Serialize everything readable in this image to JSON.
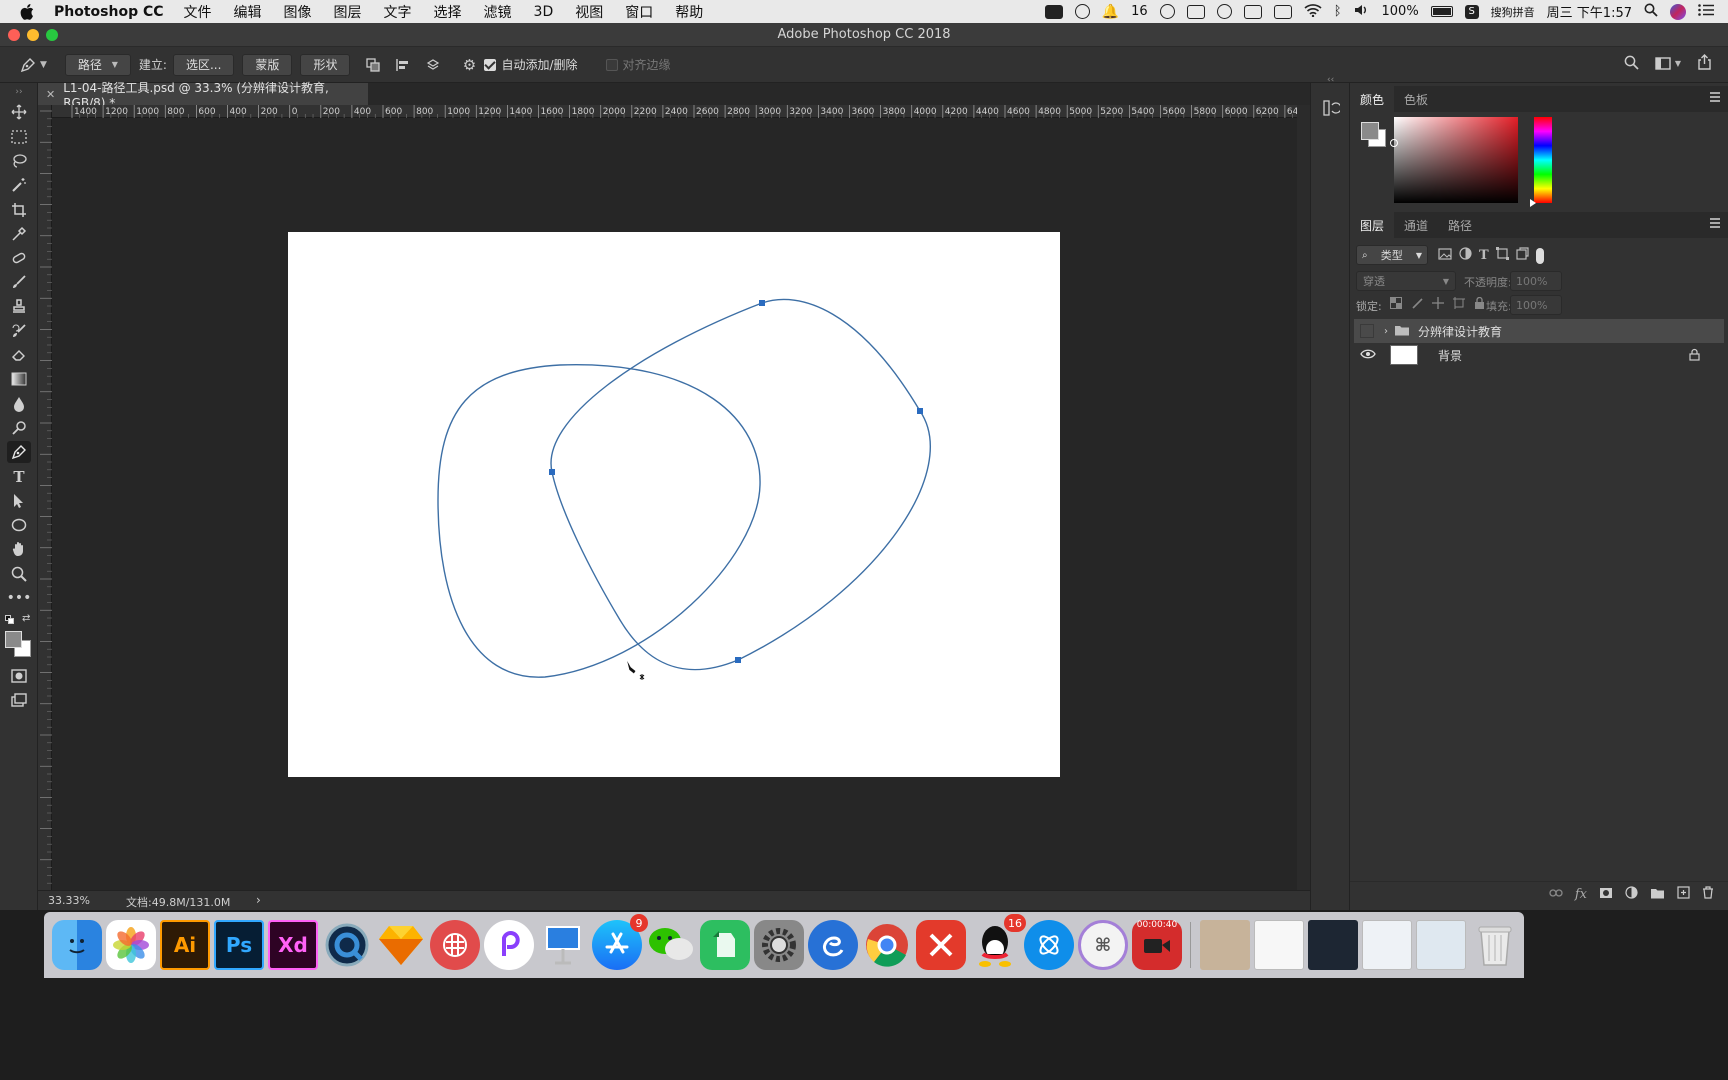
{
  "menubar": {
    "app_name": "Photoshop CC",
    "items": [
      "文件",
      "编辑",
      "图像",
      "图层",
      "文字",
      "选择",
      "滤镜",
      "3D",
      "视图",
      "窗口",
      "帮助"
    ],
    "status": {
      "notification_count": "16",
      "battery": "100%",
      "input_method": "搜狗拼音",
      "clock": "周三 下午1:57"
    }
  },
  "window": {
    "title": "Adobe Photoshop CC 2018",
    "traffic_colors": [
      "#fe5f57",
      "#febc2e",
      "#28c840"
    ]
  },
  "options": {
    "mode": "路径",
    "make_label": "建立:",
    "selection_btn": "选区...",
    "mask_btn": "蒙版",
    "shape_btn": "形状",
    "auto_add_delete": "自动添加/删除",
    "align_edges": "对齐边缘"
  },
  "toolbar": {
    "tools": [
      "move-tool",
      "marquee-tool",
      "lasso-tool",
      "magic-wand-tool",
      "crop-tool",
      "eyedropper-tool",
      "healing-brush-tool",
      "brush-tool",
      "clone-stamp-tool",
      "history-brush-tool",
      "eraser-tool",
      "gradient-tool",
      "blur-tool",
      "dodge-tool",
      "pen-tool",
      "type-tool",
      "path-selection-tool",
      "ellipse-tool",
      "hand-tool",
      "zoom-tool",
      "more-tools"
    ],
    "active": "pen-tool",
    "foreground_color": "#8a8a8a",
    "background_color": "#ffffff"
  },
  "document": {
    "tab_title": "L1-04-路径工具.psd @ 33.3% (分辨律设计教育, RGB/8) *",
    "zoom": "33.33%",
    "doc_size": "文档:49.8M/131.0M",
    "canvas_color": "#ffffff",
    "path_color": "#3d6fa5",
    "anchor_color": "#2a6bbf"
  },
  "hruler_labels": [
    "1400",
    "1200",
    "1000",
    "800",
    "600",
    "400",
    "200",
    "0",
    "200",
    "400",
    "600",
    "800",
    "1000",
    "1200",
    "1400",
    "1600",
    "1800",
    "2000",
    "2200",
    "2400",
    "2600",
    "2800",
    "3000",
    "3200",
    "3400",
    "3600",
    "3800",
    "4000",
    "4200",
    "4400",
    "4600",
    "4800",
    "5000",
    "5200",
    "5400",
    "5600",
    "5800",
    "6000",
    "6200",
    "64"
  ],
  "panels": {
    "color_tabs": [
      "颜色",
      "色板"
    ],
    "layer_tabs": [
      "图层",
      "通道",
      "路径"
    ],
    "filter_kind": "类型",
    "blend_mode": "穿透",
    "opacity_label": "不透明度:",
    "opacity_value": "100%",
    "lock_label": "锁定:",
    "fill_label": "填充:",
    "fill_value": "100%",
    "layers": [
      {
        "name": "分辨律设计教育",
        "type": "group",
        "visible": false
      },
      {
        "name": "背景",
        "type": "background",
        "visible": true,
        "locked": true
      }
    ]
  },
  "dock": {
    "apps": [
      "Finder",
      "Photos",
      "Ai",
      "Ps",
      "Xd",
      "QuickTime",
      "Sketch",
      "Scrivener",
      "PicsArt",
      "Keynote",
      "App Store",
      "WeChat",
      "Evernote",
      "System Preferences",
      "Edge",
      "Chrome",
      "WPS",
      "QQ",
      "Xcode Helper",
      "Shortcuts",
      "Recorder"
    ],
    "ai_label": "Ai",
    "ps_label": "Ps",
    "xd_label": "Xd",
    "appstore_badge": "9",
    "qq_badge": "16",
    "recorder_time": "00:00:40"
  }
}
